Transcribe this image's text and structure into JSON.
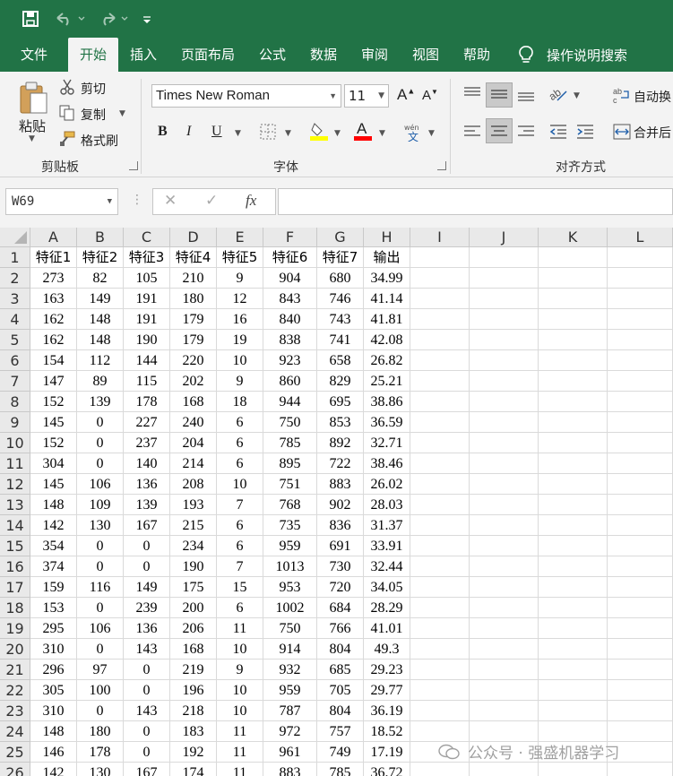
{
  "quick_access": {
    "icons": [
      "save-icon",
      "undo-icon",
      "redo-icon",
      "customize-icon"
    ]
  },
  "tabs": [
    "文件",
    "开始",
    "插入",
    "页面布局",
    "公式",
    "数据",
    "审阅",
    "视图",
    "帮助"
  ],
  "active_tab": "开始",
  "tell_me": "操作说明搜索",
  "clipboard": {
    "paste": "粘贴",
    "cut": "剪切",
    "copy": "复制",
    "format_painter": "格式刷",
    "group": "剪贴板"
  },
  "font": {
    "name": "Times New Roman",
    "size": "11",
    "bold": "B",
    "italic": "I",
    "underline": "U",
    "group": "字体",
    "highlight_color": "#ffff00",
    "font_color": "#ff0000"
  },
  "alignment": {
    "wrap_text": "自动换",
    "merge": "合并后",
    "group": "对齐方式"
  },
  "formula_bar": {
    "name_box": "W69",
    "cancel": "✕",
    "enter": "✓",
    "fx": "fx",
    "value": ""
  },
  "columns": [
    "A",
    "B",
    "C",
    "D",
    "E",
    "F",
    "G",
    "H",
    "I",
    "J",
    "K",
    "L"
  ],
  "row_numbers": [
    "1",
    "2",
    "3",
    "4",
    "5",
    "6",
    "7",
    "8",
    "9",
    "10",
    "11",
    "12",
    "13",
    "14",
    "15",
    "16",
    "17",
    "18",
    "19",
    "20",
    "21",
    "22",
    "23",
    "24",
    "25",
    "26"
  ],
  "table": {
    "headers": [
      "特征1",
      "特征2",
      "特征3",
      "特征4",
      "特征5",
      "特征6",
      "特征7",
      "输出"
    ],
    "rows": [
      [
        "273",
        "82",
        "105",
        "210",
        "9",
        "904",
        "680",
        "34.99"
      ],
      [
        "163",
        "149",
        "191",
        "180",
        "12",
        "843",
        "746",
        "41.14"
      ],
      [
        "162",
        "148",
        "191",
        "179",
        "16",
        "840",
        "743",
        "41.81"
      ],
      [
        "162",
        "148",
        "190",
        "179",
        "19",
        "838",
        "741",
        "42.08"
      ],
      [
        "154",
        "112",
        "144",
        "220",
        "10",
        "923",
        "658",
        "26.82"
      ],
      [
        "147",
        "89",
        "115",
        "202",
        "9",
        "860",
        "829",
        "25.21"
      ],
      [
        "152",
        "139",
        "178",
        "168",
        "18",
        "944",
        "695",
        "38.86"
      ],
      [
        "145",
        "0",
        "227",
        "240",
        "6",
        "750",
        "853",
        "36.59"
      ],
      [
        "152",
        "0",
        "237",
        "204",
        "6",
        "785",
        "892",
        "32.71"
      ],
      [
        "304",
        "0",
        "140",
        "214",
        "6",
        "895",
        "722",
        "38.46"
      ],
      [
        "145",
        "106",
        "136",
        "208",
        "10",
        "751",
        "883",
        "26.02"
      ],
      [
        "148",
        "109",
        "139",
        "193",
        "7",
        "768",
        "902",
        "28.03"
      ],
      [
        "142",
        "130",
        "167",
        "215",
        "6",
        "735",
        "836",
        "31.37"
      ],
      [
        "354",
        "0",
        "0",
        "234",
        "6",
        "959",
        "691",
        "33.91"
      ],
      [
        "374",
        "0",
        "0",
        "190",
        "7",
        "1013",
        "730",
        "32.44"
      ],
      [
        "159",
        "116",
        "149",
        "175",
        "15",
        "953",
        "720",
        "34.05"
      ],
      [
        "153",
        "0",
        "239",
        "200",
        "6",
        "1002",
        "684",
        "28.29"
      ],
      [
        "295",
        "106",
        "136",
        "206",
        "11",
        "750",
        "766",
        "41.01"
      ],
      [
        "310",
        "0",
        "143",
        "168",
        "10",
        "914",
        "804",
        "49.3"
      ],
      [
        "296",
        "97",
        "0",
        "219",
        "9",
        "932",
        "685",
        "29.23"
      ],
      [
        "305",
        "100",
        "0",
        "196",
        "10",
        "959",
        "705",
        "29.77"
      ],
      [
        "310",
        "0",
        "143",
        "218",
        "10",
        "787",
        "804",
        "36.19"
      ],
      [
        "148",
        "180",
        "0",
        "183",
        "11",
        "972",
        "757",
        "18.52"
      ],
      [
        "146",
        "178",
        "0",
        "192",
        "11",
        "961",
        "749",
        "17.19"
      ],
      [
        "142",
        "130",
        "167",
        "174",
        "11",
        "883",
        "785",
        "36.72"
      ]
    ]
  },
  "watermark": "公众号 · 强盛机器学习"
}
